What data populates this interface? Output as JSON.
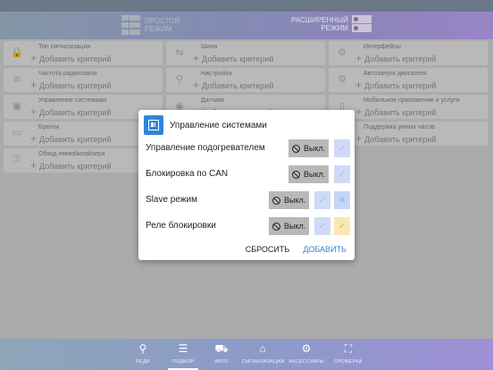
{
  "header": {
    "simple_mode": "ПРОСТОЙ РЕЖИМ",
    "simple_mode_l1": "ПРОСТОЙ",
    "simple_mode_l2": "РЕЖИМ",
    "advanced_l1": "РАСШИРЕННЫЙ",
    "advanced_l2": "РЕЖИМ"
  },
  "grid": {
    "add_label": "Добавить критерий",
    "cells": [
      {
        "title": "Тип сигнализации",
        "icon": "lock-icon"
      },
      {
        "title": "Шина",
        "icon": "bus-icon"
      },
      {
        "title": "Интерфейсы",
        "icon": "interface-icon"
      },
      {
        "title": "Частота радиосвязи",
        "icon": "radio-icon"
      },
      {
        "title": "Настройка",
        "icon": "usb-icon"
      },
      {
        "title": "Автозапуск двигателя",
        "icon": "engine-icon"
      },
      {
        "title": "Управление системами",
        "icon": "system-icon"
      },
      {
        "title": "Датчики",
        "icon": "sensor-icon"
      },
      {
        "title": "Мобильное приложение и услуги",
        "icon": "mobile-icon"
      },
      {
        "title": "Брелок",
        "icon": "keyfob-icon"
      },
      {
        "title": "",
        "icon": ""
      },
      {
        "title": "Поддержка умных часов",
        "icon": "watch-icon"
      },
      {
        "title": "Обход иммобилайзера",
        "icon": "immobilizer-icon"
      }
    ]
  },
  "dialog": {
    "title": "Управление системами",
    "off_label": "Выкл.",
    "rows": [
      {
        "label": "Управление подогревателем"
      },
      {
        "label": "Блокировка по CAN"
      },
      {
        "label": "Slave режим"
      },
      {
        "label": "Реле блокировки"
      }
    ],
    "reset": "СБРОСИТЬ",
    "add": "ДОБАВИТЬ"
  },
  "nav": {
    "items": [
      {
        "label": "РЕДИ",
        "icon": "pin-icon"
      },
      {
        "label": "ПОДБОР",
        "icon": "sliders-icon"
      },
      {
        "label": "АВТО",
        "icon": "car-icon"
      },
      {
        "label": "СИГНАЛИЗАЦИИ",
        "icon": "alarm-icon"
      },
      {
        "label": "АКСЕССУАРЫ",
        "icon": "gear-icon"
      },
      {
        "label": "ПРОВЕРКА",
        "icon": "expand-icon"
      }
    ]
  },
  "colors": {
    "accent": "#2f86d6",
    "off_button": "#b8b8b8",
    "option_blue": "#cfdaf7",
    "option_yellow": "#fbe7b3"
  }
}
